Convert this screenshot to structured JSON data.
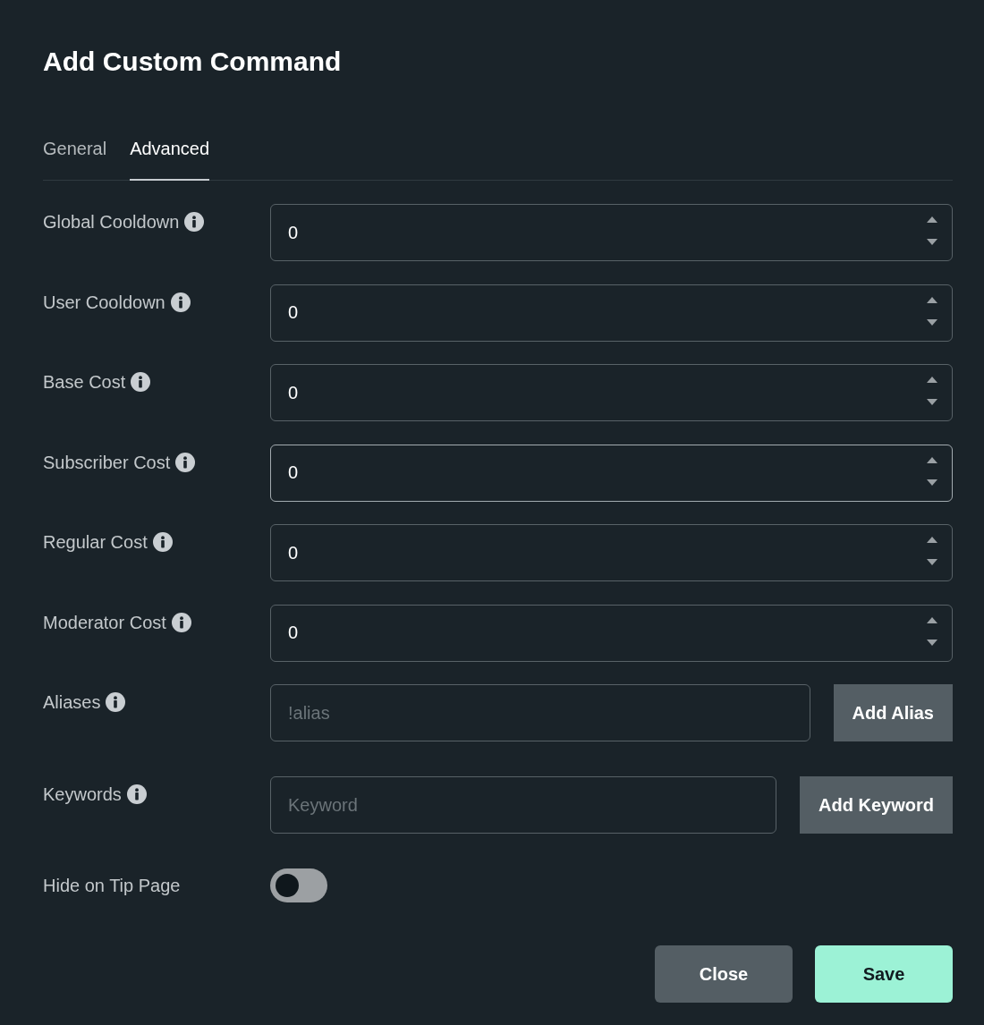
{
  "dialog": {
    "title": "Add Custom Command"
  },
  "tabs": [
    {
      "label": "General",
      "selected": false
    },
    {
      "label": "Advanced",
      "selected": true
    }
  ],
  "fields": [
    {
      "kind": "number",
      "label": "Global Cooldown",
      "info": true,
      "value": "0",
      "focused": false
    },
    {
      "kind": "number",
      "label": "User Cooldown",
      "info": true,
      "value": "0",
      "focused": false
    },
    {
      "kind": "number",
      "label": "Base Cost",
      "info": true,
      "value": "0",
      "focused": false
    },
    {
      "kind": "number",
      "label": "Subscriber Cost",
      "info": true,
      "value": "0",
      "focused": true
    },
    {
      "kind": "number",
      "label": "Regular Cost",
      "info": true,
      "value": "0",
      "focused": false
    },
    {
      "kind": "number",
      "label": "Moderator Cost",
      "info": true,
      "value": "0",
      "focused": false
    },
    {
      "kind": "text_button",
      "label": "Aliases",
      "info": true,
      "placeholder": "!alias",
      "button": "Add Alias"
    },
    {
      "kind": "text_button",
      "label": "Keywords",
      "info": true,
      "placeholder": "Keyword",
      "button": "Add Keyword"
    },
    {
      "kind": "toggle",
      "label": "Hide on Tip Page",
      "info": false,
      "on": false
    }
  ],
  "buttons": [
    {
      "label": "Close",
      "kind": "secondary"
    },
    {
      "label": "Save",
      "kind": "primary"
    }
  ]
}
